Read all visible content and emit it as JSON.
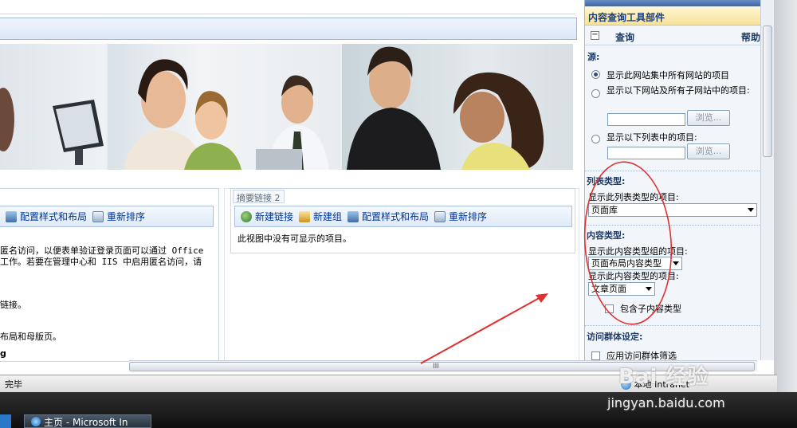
{
  "colors": {
    "accent": "#1c3f7a",
    "link": "#003399",
    "annotation": "#e03030"
  },
  "webparts": {
    "left": {
      "toolbar": {
        "style_layout": "配置样式和布局",
        "reorder": "重新排序"
      },
      "lines": [
        "匿名访问，以便表单验证登录页面可以通过 Office",
        "工作。若要在管理中心和 IIS 中启用匿名访问，请",
        "链接。",
        "布局和母版页。",
        "g"
      ]
    },
    "right": {
      "title": "摘要链接",
      "count": "2",
      "toolbar": {
        "new_link": "新建链接",
        "new_group": "新建组",
        "style_layout": "配置样式和布局",
        "reorder": "重新排序"
      },
      "empty_message": "此视图中没有可显示的项目。"
    }
  },
  "status": {
    "text": "完毕",
    "zone": "本地 Intranet",
    "scroll_grip": "III"
  },
  "taskbar": {
    "window_label": "主页 - Microsoft In"
  },
  "tool_pane": {
    "header": "内容查询工具部件",
    "query_label": "查询",
    "help_label": "帮助",
    "source_label": "源:",
    "source_options": [
      {
        "label": "显示此网站集中所有网站的项目",
        "checked": true
      },
      {
        "label": "显示以下网站及所有子网站中的项目:",
        "checked": false
      },
      {
        "label": "显示以下列表中的项目:",
        "checked": false
      }
    ],
    "browse_label": "浏览...",
    "list_type_label": "列表类型:",
    "list_type_sub": "显示此列表类型的项目:",
    "list_type_value": "页面库",
    "content_type_label": "内容类型:",
    "content_group_sub": "显示此内容类型组的项目:",
    "content_group_value": "页面布局内容类型",
    "content_type_sub": "显示此内容类型的项目:",
    "content_type_value": "文章页面",
    "include_children": "包含子内容类型",
    "audience_label": "访问群体设定:",
    "apply_audience": "应用访问群体筛选"
  },
  "watermark": {
    "logo": "Bai 经验",
    "url": "jingyan.baidu.com"
  }
}
